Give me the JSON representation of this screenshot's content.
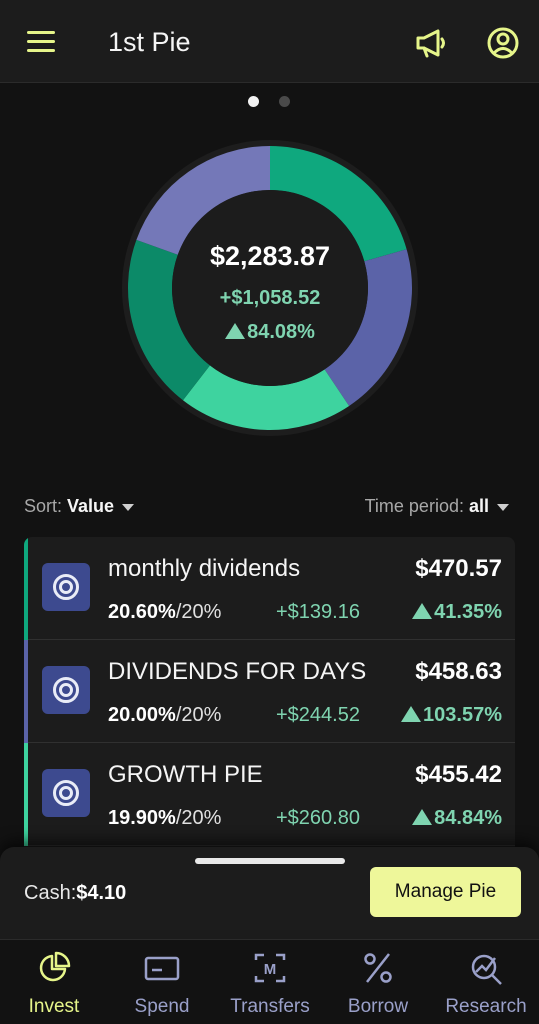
{
  "header": {
    "title": "1st Pie",
    "menu_icon": "menu-icon",
    "right_icons": [
      "megaphone-icon",
      "profile-icon"
    ]
  },
  "carousel": {
    "pages": 2,
    "active_index": 0
  },
  "pie": {
    "total_value": "$2,283.87",
    "gain": "+$1,058.52",
    "gain_pct": "84.08%",
    "segment_colors": [
      "#0fa87e",
      "#5b63a8",
      "#3ed39f",
      "#0c8a68",
      "#7478b8"
    ],
    "segment_values": [
      20.6,
      20.0,
      19.9,
      20.0,
      19.5
    ]
  },
  "sort": {
    "label": "Sort:",
    "value": "Value"
  },
  "period": {
    "label": "Time period:",
    "value": "all"
  },
  "holdings": [
    {
      "name": "monthly dividends",
      "value": "$470.57",
      "alloc_current": "20.60%",
      "alloc_target": "/20%",
      "gain": "+$139.16",
      "gain_pct": "41.35%",
      "color": "#0fa87e"
    },
    {
      "name": "DIVIDENDS FOR DAYS",
      "value": "$458.63",
      "alloc_current": "20.00%",
      "alloc_target": "/20%",
      "gain": "+$244.52",
      "gain_pct": "103.57%",
      "color": "#5b63a8"
    },
    {
      "name": "GROWTH PIE",
      "value": "$455.42",
      "alloc_current": "19.90%",
      "alloc_target": "/20%",
      "gain": "+$260.80",
      "gain_pct": "84.84%",
      "color": "#3ed39f"
    }
  ],
  "sheet": {
    "cash_label": "Cash:",
    "cash_value": "$4.10",
    "manage_button": "Manage Pie"
  },
  "nav": [
    {
      "label": "Invest",
      "icon": "pie-chart-icon",
      "active": true
    },
    {
      "label": "Spend",
      "icon": "card-icon",
      "active": false
    },
    {
      "label": "Transfers",
      "icon": "transfer-icon",
      "active": false
    },
    {
      "label": "Borrow",
      "icon": "percent-icon",
      "active": false
    },
    {
      "label": "Research",
      "icon": "research-icon",
      "active": false
    }
  ],
  "colors": {
    "accent": "#e6f58a",
    "gain": "#7fd4b0",
    "background": "#121212",
    "surface": "#1c1c1c"
  }
}
